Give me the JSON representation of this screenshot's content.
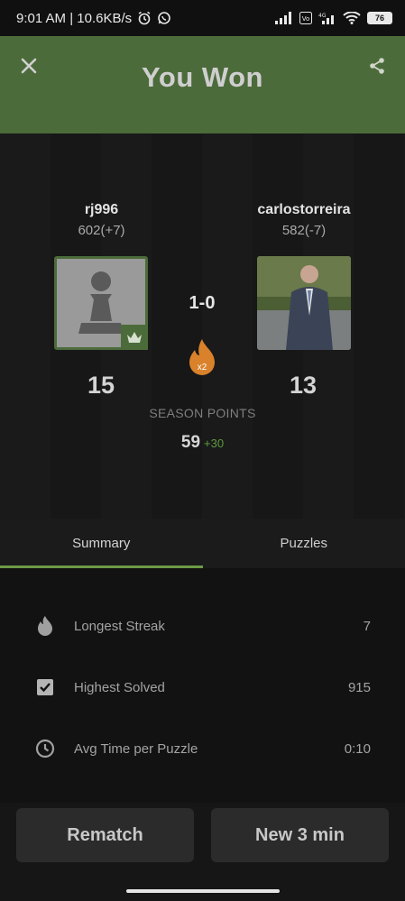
{
  "status_bar": {
    "time_speed": "9:01 AM | 10.6KB/s",
    "battery": "76",
    "network": "4G"
  },
  "header": {
    "title": "You Won"
  },
  "players": {
    "left": {
      "name": "rj996",
      "rating": "602(+7)",
      "score": "15"
    },
    "right": {
      "name": "carlostorreira",
      "rating": "582(-7)",
      "score": "13"
    }
  },
  "match": {
    "result": "1-0",
    "streak_multiplier": "x2",
    "season_label": "SEASON POINTS",
    "season_points": "59",
    "season_gain": "+30"
  },
  "tabs": [
    {
      "label": "Summary",
      "active": true
    },
    {
      "label": "Puzzles",
      "active": false
    }
  ],
  "stats": [
    {
      "icon": "flame-icon",
      "label": "Longest Streak",
      "value": "7"
    },
    {
      "icon": "checkbox-icon",
      "label": "Highest Solved",
      "value": "915"
    },
    {
      "icon": "clock-icon",
      "label": "Avg Time per Puzzle",
      "value": "0:10"
    }
  ],
  "buttons": {
    "rematch": "Rematch",
    "new_game": "New 3 min"
  },
  "colors": {
    "header_green": "#4c6b3a",
    "accent_green": "#6c9a45",
    "gain_green": "#5f9a3f",
    "flame_orange": "#d9822b"
  }
}
